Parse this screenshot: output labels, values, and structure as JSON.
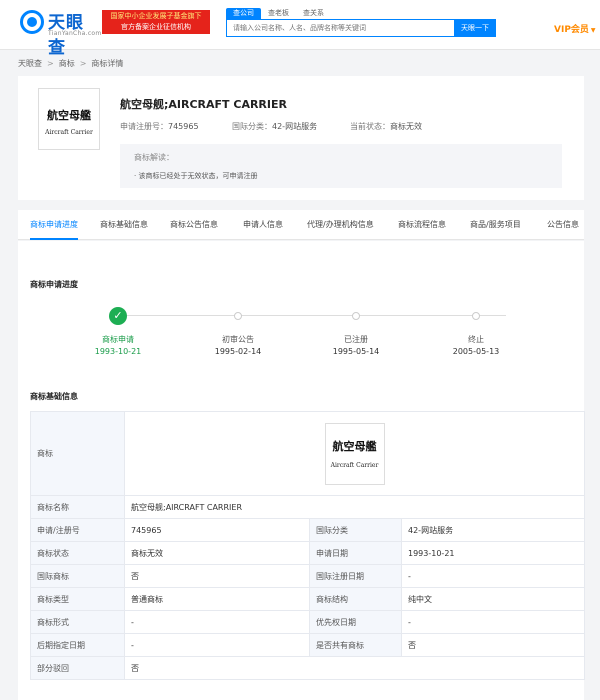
{
  "header": {
    "logo_text": "天眼查",
    "logo_sub": "TianYanCha.com",
    "gov_badge_line1": "国家中小企业发展子基金旗下",
    "gov_badge_line2": "官方备案企业征信机构",
    "search_tabs": [
      "查公司",
      "查老板",
      "查关系"
    ],
    "search_placeholder": "请输入公司名称、人名、品牌名称等关键词",
    "search_button": "天眼一下",
    "vip_label": "VIP会员"
  },
  "breadcrumb": [
    "天眼查",
    "商标",
    "商标详情"
  ],
  "trademark": {
    "image_cn": "航空母艦",
    "image_en": "Aircraft Carrier",
    "title": "航空母舰;AIRCRAFT CARRIER",
    "reg_no_label": "申请注册号：",
    "reg_no": "745965",
    "class_label": "国际分类：",
    "class_value": "42-网站服务",
    "status_label": "当前状态：",
    "status_value": "商标无效",
    "note_heading": "商标解读：",
    "note_text": "· 该商标已经处于无效状态，可申请注册"
  },
  "tabs": [
    "商标申请进度",
    "商标基础信息",
    "商标公告信息",
    "申请人信息",
    "代理/办理机构信息",
    "商标流程信息",
    "商品/服务项目",
    "公告信息"
  ],
  "progress": {
    "title": "商标申请进度",
    "steps": [
      {
        "name": "商标申请",
        "date": "1993-10-21"
      },
      {
        "name": "初审公告",
        "date": "1995-02-14"
      },
      {
        "name": "已注册",
        "date": "1995-05-14"
      },
      {
        "name": "终止",
        "date": "2005-05-13"
      }
    ],
    "current_step": 0
  },
  "basic_info": {
    "title": "商标基础信息",
    "image_label": "商标",
    "name_label": "商标名称",
    "name_value": "航空母舰;AIRCRAFT CARRIER",
    "rows": [
      {
        "l1": "申请/注册号",
        "v1": "745965",
        "l2": "国际分类",
        "v2": "42-网站服务"
      },
      {
        "l1": "商标状态",
        "v1": "商标无效",
        "l2": "申请日期",
        "v2": "1993-10-21"
      },
      {
        "l1": "国际商标",
        "v1": "否",
        "l2": "国际注册日期",
        "v2": "-"
      },
      {
        "l1": "商标类型",
        "v1": "普通商标",
        "l2": "商标结构",
        "v2": "纯中文"
      },
      {
        "l1": "商标形式",
        "v1": "-",
        "l2": "优先权日期",
        "v2": "-"
      },
      {
        "l1": "后期指定日期",
        "v1": "-",
        "l2": "是否共有商标",
        "v2": "否"
      }
    ],
    "partial_reject_label": "部分驳回",
    "partial_reject_value": "否"
  },
  "colors": {
    "brand": "#0084ff",
    "gov_badge": "#e5231b",
    "vip": "#ff8a00",
    "done_step": "#1dae53"
  }
}
